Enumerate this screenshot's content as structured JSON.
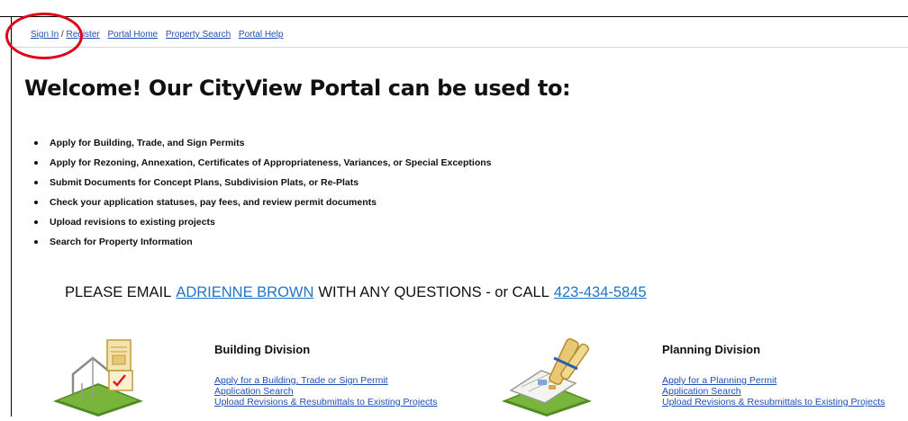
{
  "top_nav": {
    "sign_in": "Sign In",
    "separator": "/",
    "register": "Register",
    "portal_home": "Portal Home",
    "property_search": "Property Search",
    "portal_help": "Portal Help"
  },
  "hero": {
    "title": "Welcome! Our CityView Portal can be used to:"
  },
  "features": [
    "Apply for Building, Trade, and Sign Permits",
    "Apply for Rezoning, Annexation, Certificates of Appropriateness, Variances, or Special Exceptions",
    "Submit Documents for Concept Plans, Subdivision Plats, or Re-Plats",
    "Check your application statuses, pay fees, and review permit documents",
    "Upload revisions to existing projects",
    "Search for Property Information"
  ],
  "contact": {
    "prefix": "PLEASE EMAIL",
    "email_name": "ADRIENNE BROWN",
    "middle": "WITH ANY QUESTIONS - or CALL",
    "phone": "423-434-5845"
  },
  "divisions": {
    "building": {
      "title": "Building Division",
      "icon": "house-permit-icon",
      "links": [
        "Apply for a Building, Trade or Sign Permit",
        "Application Search",
        "Upload Revisions & Resubmittals to Existing Projects"
      ]
    },
    "planning": {
      "title": "Planning Division",
      "icon": "planning-blueprint-icon",
      "links": [
        "Apply for a Planning Permit",
        "Application Search",
        "Upload Revisions & Resubmittals to Existing Projects"
      ]
    }
  },
  "colors": {
    "link": "#1f4fb5",
    "contact_link": "#1f74c9",
    "highlight_circle": "#e0001a",
    "icon_green": "#5b9a2a"
  }
}
